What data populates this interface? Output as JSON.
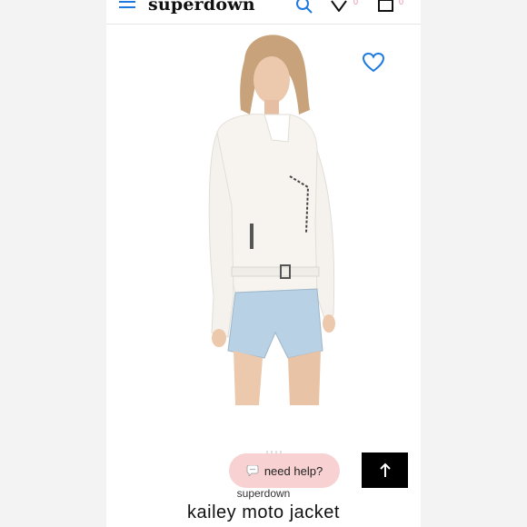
{
  "header": {
    "logo": "superdown",
    "wishlist_count": "0",
    "bag_count": "0"
  },
  "product": {
    "brand": "superdown",
    "name": "kailey moto jacket"
  },
  "chat": {
    "label": "need help?"
  },
  "icons": {
    "menu": "menu-icon",
    "search": "search-icon",
    "wishlist": "heart-icon",
    "bag": "bag-icon",
    "favorite": "heart-outline-icon",
    "chat": "chat-bubble-icon",
    "scroll_top": "arrow-up-icon"
  },
  "colors": {
    "accent_blue": "#1f7ae0",
    "badge_pink": "#e28aa4",
    "chat_pill": "#f8d2d2",
    "top_button": "#000000"
  }
}
